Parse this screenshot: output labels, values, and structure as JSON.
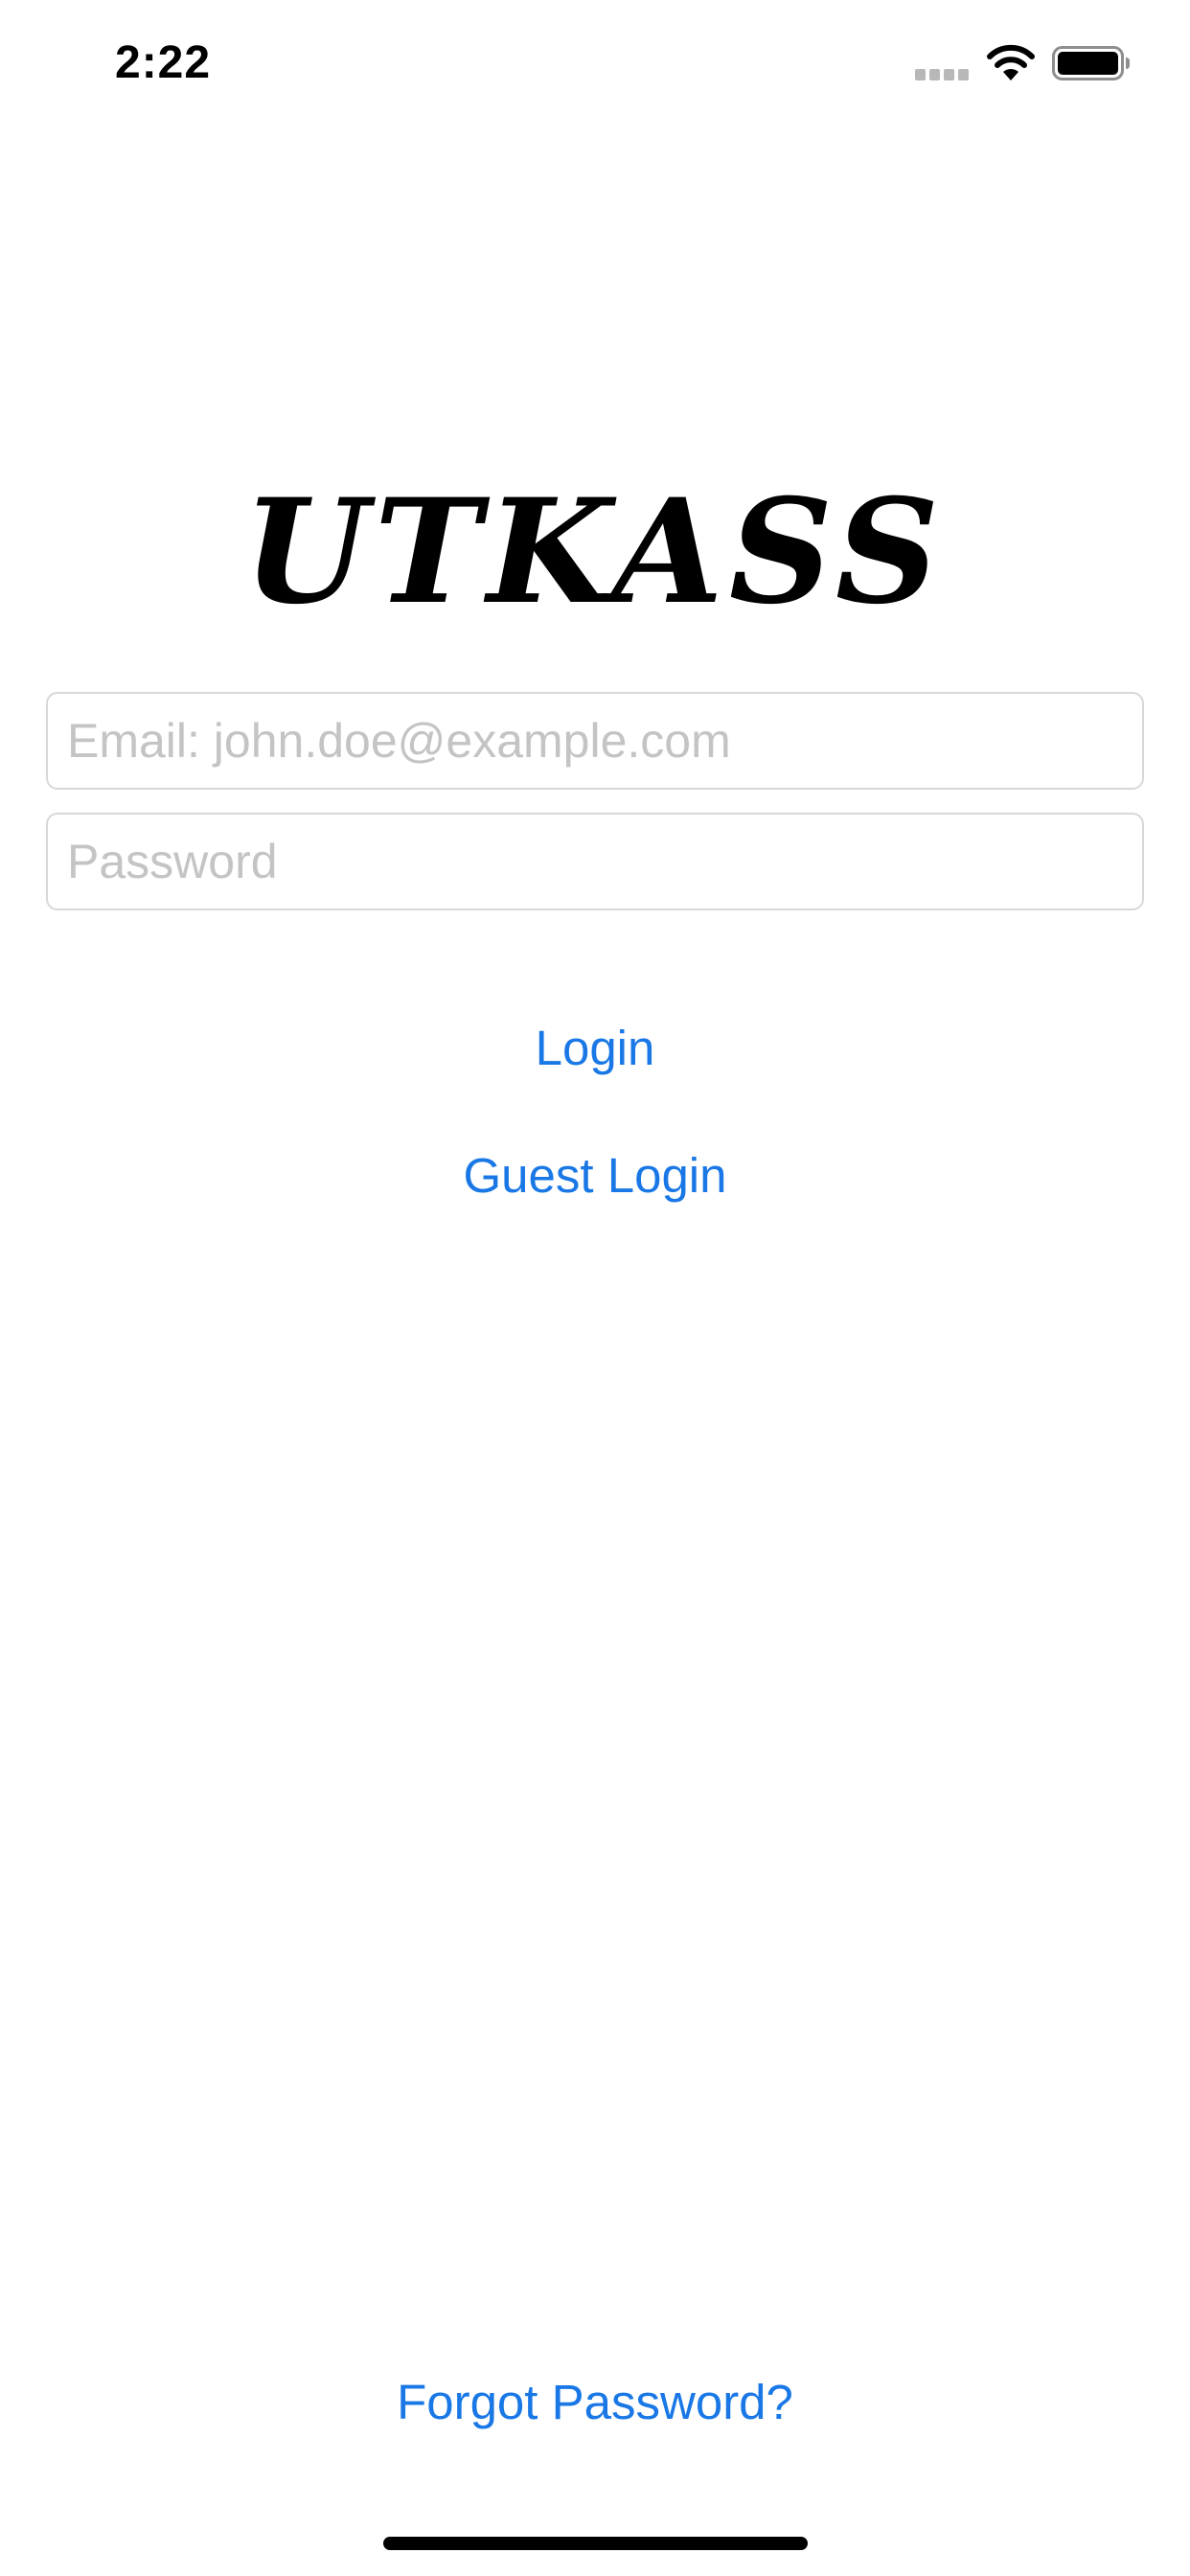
{
  "status_bar": {
    "time": "2:22",
    "signal_icon": "signal-dots-icon",
    "wifi_icon": "wifi-icon",
    "battery_icon": "battery-full-icon"
  },
  "logo": {
    "text": "UTKASS"
  },
  "login_form": {
    "email_placeholder": "Email: john.doe@example.com",
    "email_value": "",
    "password_placeholder": "Password",
    "password_value": "",
    "login_label": "Login",
    "guest_login_label": "Guest Login",
    "forgot_password_label": "Forgot Password?"
  },
  "colors": {
    "accent": "#1a78e6",
    "placeholder": "#c4c4c6",
    "field_border": "#d8d8d8",
    "background": "#ffffff"
  }
}
